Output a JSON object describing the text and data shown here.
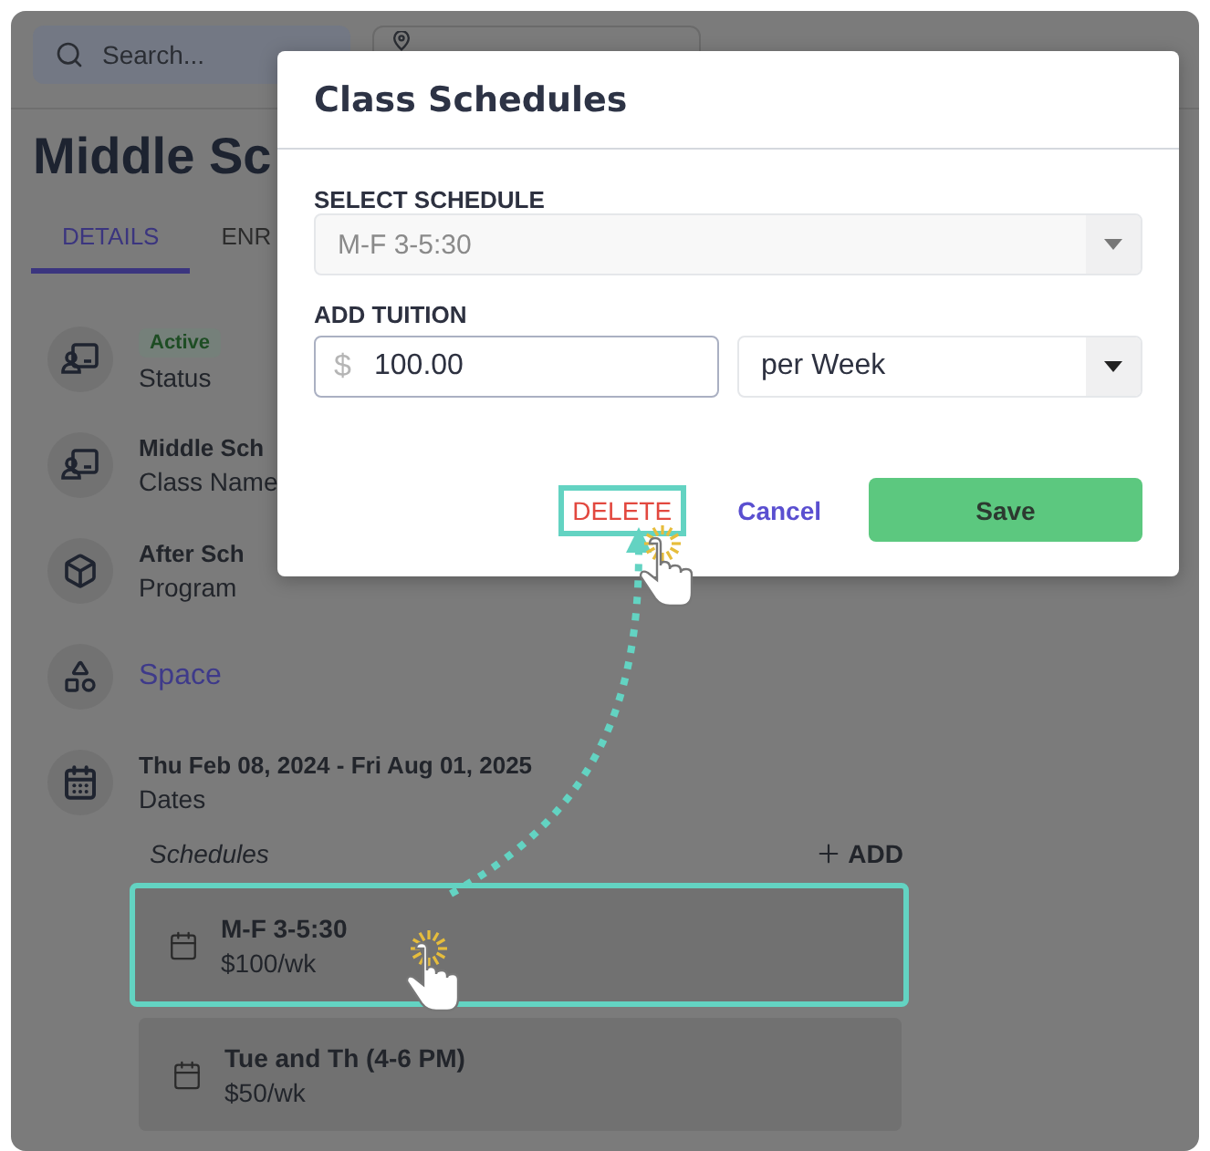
{
  "header": {
    "search": {
      "placeholder": "Search..."
    }
  },
  "page": {
    "title": "Middle Sc",
    "tabs": [
      {
        "label": "DETAILS",
        "selected": true
      },
      {
        "label": "ENR",
        "selected": false
      }
    ],
    "fields": [
      {
        "kind": "badge",
        "value": "Active",
        "label": "Status"
      },
      {
        "kind": "text",
        "value": "Middle Sch",
        "label": "Class Name"
      },
      {
        "kind": "text",
        "value": "After Sch",
        "label": "Program"
      },
      {
        "kind": "link",
        "value": "Space"
      },
      {
        "kind": "text",
        "value": "Thu Feb 08, 2024 - Fri Aug 01, 2025",
        "label": "Dates"
      }
    ],
    "schedules": {
      "label": "Schedules",
      "add_button": "ADD",
      "items": [
        {
          "title": "M-F 3-5:30",
          "price": "$100/wk",
          "highlighted": true
        },
        {
          "title": "Tue and Th (4-6 PM)",
          "price": "$50/wk",
          "highlighted": false
        }
      ]
    }
  },
  "modal": {
    "title": "Class Schedules",
    "schedule": {
      "label": "SELECT SCHEDULE",
      "value": "M-F 3-5:30",
      "disabled": true
    },
    "tuition": {
      "label": "ADD TUITION",
      "currency": "$",
      "value": "100.00",
      "period": "per Week"
    },
    "buttons": {
      "delete": "DELETE",
      "cancel": "Cancel",
      "save": "Save"
    },
    "delete_highlighted": true
  }
}
